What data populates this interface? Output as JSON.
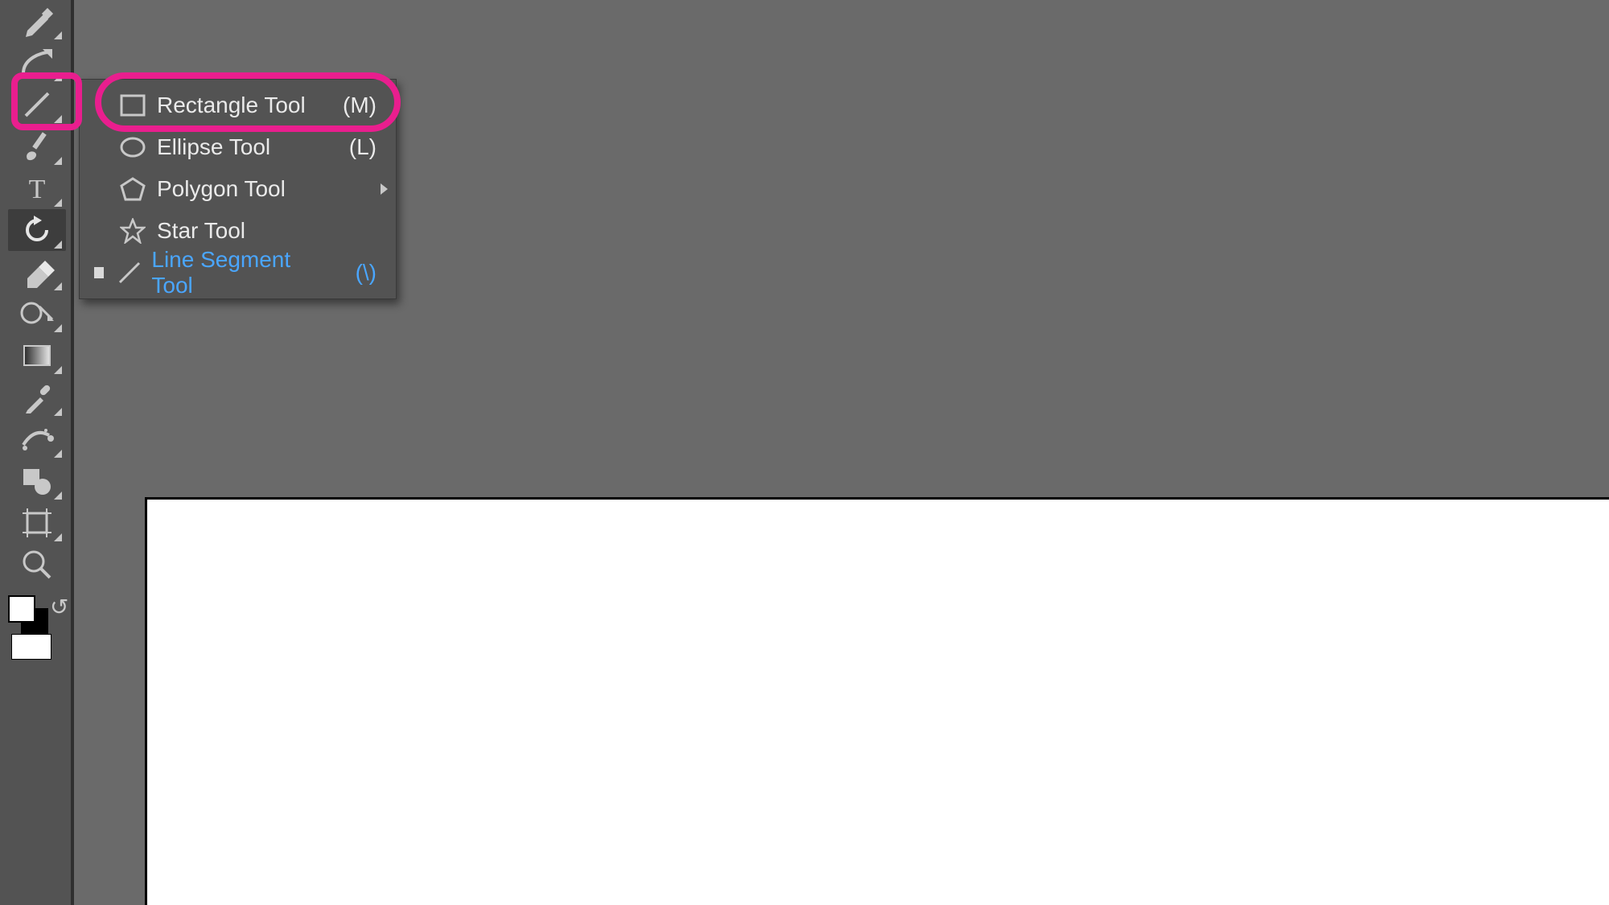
{
  "toolbar": {
    "tools": [
      {
        "name": "pen-tool",
        "icon": "pen",
        "corner": true
      },
      {
        "name": "curvature-tool",
        "icon": "curvature",
        "corner": true
      },
      {
        "name": "line-segment-tool",
        "icon": "line",
        "corner": true,
        "highlighted": true
      },
      {
        "name": "paintbrush-tool",
        "icon": "brush",
        "corner": true
      },
      {
        "name": "type-tool",
        "icon": "type",
        "corner": true
      },
      {
        "name": "rotate-tool",
        "icon": "rotate",
        "corner": true,
        "selected": true
      },
      {
        "name": "eraser-tool",
        "icon": "eraser",
        "corner": true
      },
      {
        "name": "shape-builder-tool",
        "icon": "shapebuilder",
        "corner": true
      },
      {
        "name": "gradient-tool",
        "icon": "gradient",
        "corner": true
      },
      {
        "name": "eyedropper-tool",
        "icon": "eyedropper",
        "corner": true
      },
      {
        "name": "symbol-sprayer-tool",
        "icon": "sprayer",
        "corner": true
      },
      {
        "name": "shaper-tool",
        "icon": "shaper",
        "corner": true
      },
      {
        "name": "artboard-tool",
        "icon": "artboard",
        "corner": true
      },
      {
        "name": "zoom-tool",
        "icon": "zoom",
        "corner": false
      }
    ]
  },
  "flyout": {
    "items": [
      {
        "label": "Rectangle Tool",
        "shortcut": "(M)",
        "icon": "rect",
        "active": false,
        "highlight": false,
        "submenu": false,
        "name": "rectangle-tool"
      },
      {
        "label": "Ellipse Tool",
        "shortcut": "(L)",
        "icon": "ellipse",
        "active": false,
        "highlight": false,
        "submenu": false,
        "name": "ellipse-tool"
      },
      {
        "label": "Polygon Tool",
        "shortcut": "",
        "icon": "polygon",
        "active": false,
        "highlight": false,
        "submenu": true,
        "name": "polygon-tool"
      },
      {
        "label": "Star Tool",
        "shortcut": "",
        "icon": "star",
        "active": false,
        "highlight": false,
        "submenu": false,
        "name": "star-tool"
      },
      {
        "label": "Line Segment Tool",
        "shortcut": "(\\)",
        "icon": "line",
        "active": true,
        "highlight": true,
        "submenu": false,
        "name": "line-segment-tool-item"
      }
    ]
  },
  "annotation": {
    "color": "#e91e8e"
  }
}
